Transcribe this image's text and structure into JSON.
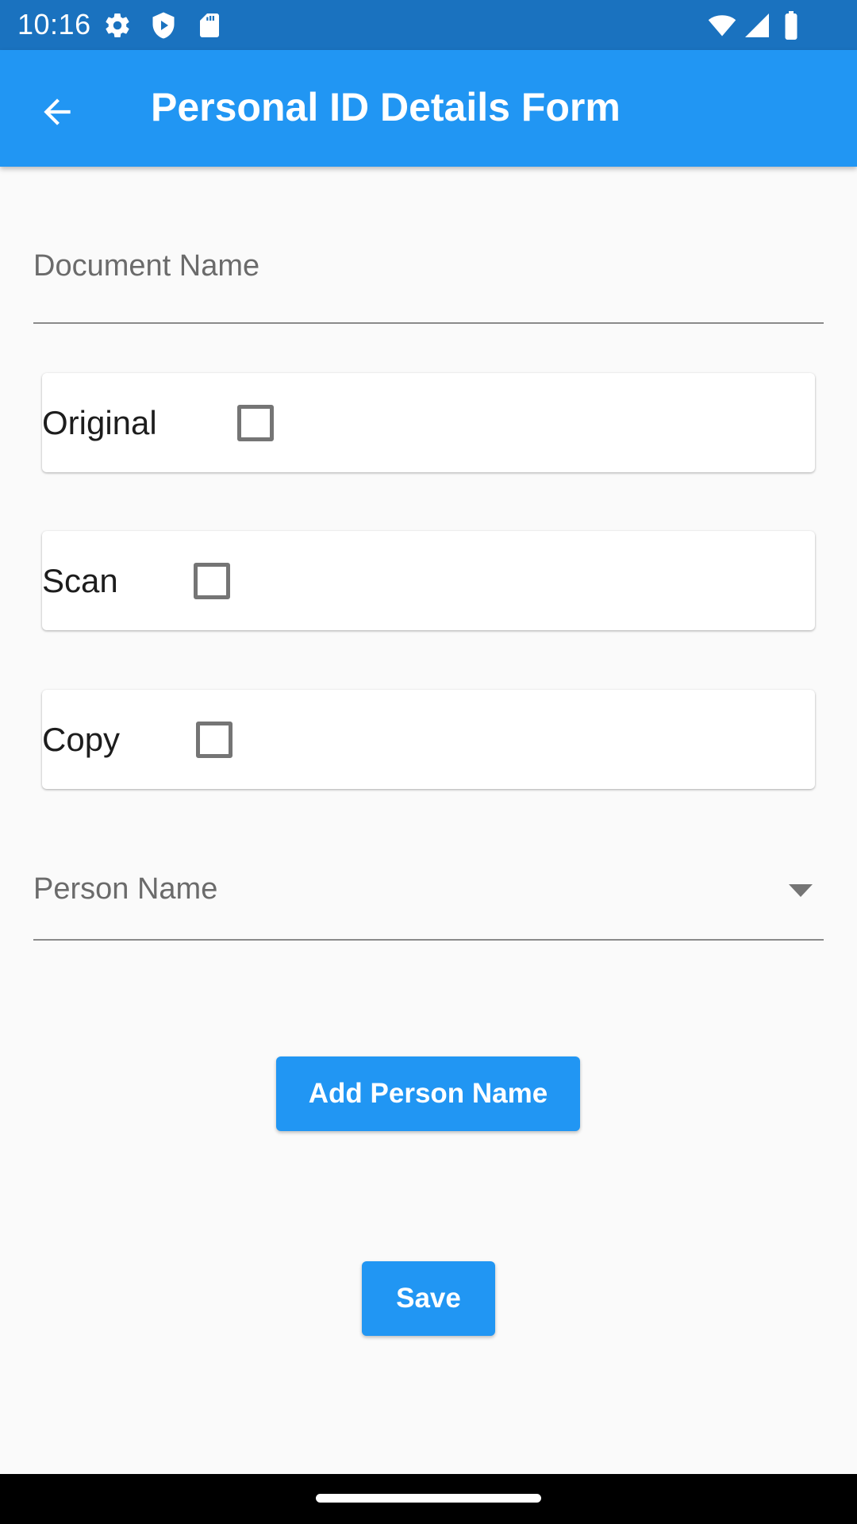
{
  "status_bar": {
    "time": "10:16",
    "icons_left": [
      "gear-icon",
      "shield-play-icon",
      "sd-card-icon"
    ],
    "icons_right": [
      "wifi-icon",
      "signal-icon",
      "battery-icon"
    ]
  },
  "app_bar": {
    "title": "Personal ID Details Form",
    "back_icon": "arrow-back-icon",
    "color": "#2196f3"
  },
  "form": {
    "document_name": {
      "placeholder": "Document Name",
      "value": ""
    },
    "checkboxes": [
      {
        "label": "Original",
        "checked": false
      },
      {
        "label": "Scan",
        "checked": false
      },
      {
        "label": "Copy",
        "checked": false
      }
    ],
    "person_name": {
      "placeholder": "Person Name",
      "icon": "dropdown-arrow-icon"
    },
    "add_person_button": "Add Person Name",
    "save_button": "Save"
  },
  "colors": {
    "accent": "#2196f3",
    "status_bar": "#1a72bf",
    "background": "#fafafa"
  }
}
